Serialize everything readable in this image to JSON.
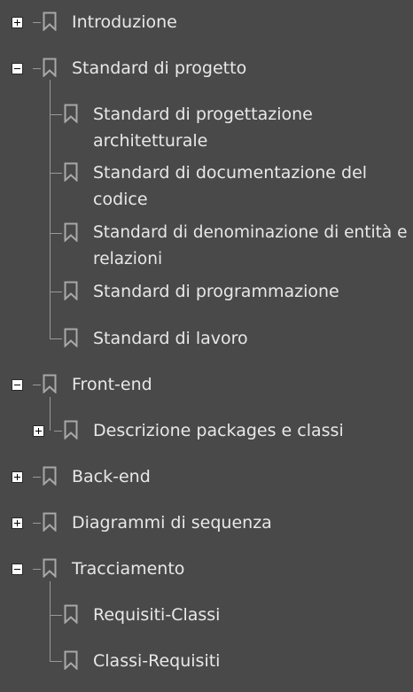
{
  "bookmarks": [
    {
      "label": "Introduzione",
      "level": 0,
      "expandable": true,
      "expanded": false
    },
    {
      "label": "Standard di progetto",
      "level": 0,
      "expandable": true,
      "expanded": true
    },
    {
      "label": "Standard di progettazione architetturale",
      "level": 1,
      "expandable": false
    },
    {
      "label": "Standard di documentazione del codice",
      "level": 1,
      "expandable": false
    },
    {
      "label": "Standard di denominazione di entità e relazioni",
      "level": 1,
      "expandable": false
    },
    {
      "label": "Standard di programmazione",
      "level": 1,
      "expandable": false
    },
    {
      "label": "Standard di lavoro",
      "level": 1,
      "expandable": false
    },
    {
      "label": "Front-end",
      "level": 0,
      "expandable": true,
      "expanded": true
    },
    {
      "label": "Descrizione packages e classi",
      "level": 1,
      "expandable": true,
      "expanded": false
    },
    {
      "label": "Back-end",
      "level": 0,
      "expandable": true,
      "expanded": false
    },
    {
      "label": "Diagrammi di sequenza",
      "level": 0,
      "expandable": true,
      "expanded": false
    },
    {
      "label": "Tracciamento",
      "level": 0,
      "expandable": true,
      "expanded": true
    },
    {
      "label": "Requisiti-Classi",
      "level": 1,
      "expandable": false
    },
    {
      "label": "Classi-Requisiti",
      "level": 1,
      "expandable": false
    }
  ],
  "colors": {
    "background": "#494949",
    "text": "#e8e8e8",
    "connector": "#9a9a9a",
    "bookmark_icon": "#a8a8a8"
  }
}
